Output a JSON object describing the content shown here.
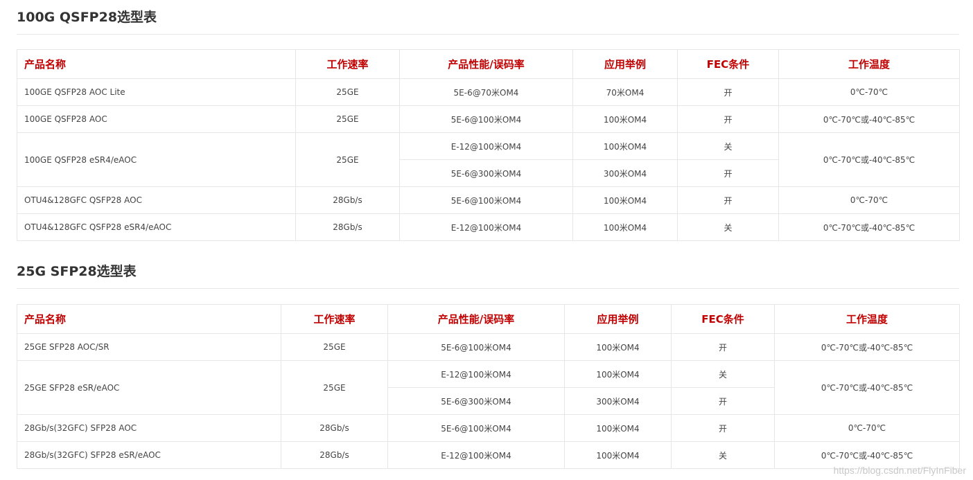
{
  "sections": [
    {
      "title": "100G QSFP28选型表",
      "headers": [
        "产品名称",
        "工作速率",
        "产品性能/误码率",
        "应用举例",
        "FEC条件",
        "工作温度"
      ],
      "rows": [
        {
          "product": "100GE QSFP28 AOC Lite",
          "rate": "25GE",
          "ber": "5E-6@70米OM4",
          "app": "70米OM4",
          "fec": "开",
          "temp": "0℃-70℃"
        },
        {
          "product": "100GE QSFP28 AOC",
          "rate": "25GE",
          "ber": "5E-6@100米OM4",
          "app": "100米OM4",
          "fec": "开",
          "temp": "0℃-70℃或-40℃-85℃"
        },
        {
          "product": "100GE QSFP28 eSR4/eAOC",
          "rate": "25GE",
          "ber": "E-12@100米OM4",
          "app": "100米OM4",
          "fec": "关",
          "temp": "0℃-70℃或-40℃-85℃"
        },
        {
          "ber": "5E-6@300米OM4",
          "app": "300米OM4",
          "fec": "开"
        },
        {
          "product": "OTU4&128GFC QSFP28 AOC",
          "rate": "28Gb/s",
          "ber": "5E-6@100米OM4",
          "app": "100米OM4",
          "fec": "开",
          "temp": "0℃-70℃"
        },
        {
          "product": "OTU4&128GFC QSFP28 eSR4/eAOC",
          "rate": "28Gb/s",
          "ber": "E-12@100米OM4",
          "app": "100米OM4",
          "fec": "关",
          "temp": "0℃-70℃或-40℃-85℃"
        }
      ]
    },
    {
      "title": "25G SFP28选型表",
      "headers": [
        "产品名称",
        "工作速率",
        "产品性能/误码率",
        "应用举例",
        "FEC条件",
        "工作温度"
      ],
      "rows": [
        {
          "product": "25GE SFP28 AOC/SR",
          "rate": "25GE",
          "ber": "5E-6@100米OM4",
          "app": "100米OM4",
          "fec": "开",
          "temp": "0℃-70℃或-40℃-85℃"
        },
        {
          "product": "25GE SFP28 eSR/eAOC",
          "rate": "25GE",
          "ber": "E-12@100米OM4",
          "app": "100米OM4",
          "fec": "关",
          "temp": "0℃-70℃或-40℃-85℃"
        },
        {
          "ber": "5E-6@300米OM4",
          "app": "300米OM4",
          "fec": "开"
        },
        {
          "product": "28Gb/s(32GFC) SFP28 AOC",
          "rate": "28Gb/s",
          "ber": "5E-6@100米OM4",
          "app": "100米OM4",
          "fec": "开",
          "temp": "0℃-70℃"
        },
        {
          "product": "28Gb/s(32GFC) SFP28 eSR/eAOC",
          "rate": "28Gb/s",
          "ber": "E-12@100米OM4",
          "app": "100米OM4",
          "fec": "关",
          "temp": "0℃-70℃或-40℃-85℃"
        }
      ]
    }
  ],
  "watermark": "https://blog.csdn.net/FlyInFiber"
}
